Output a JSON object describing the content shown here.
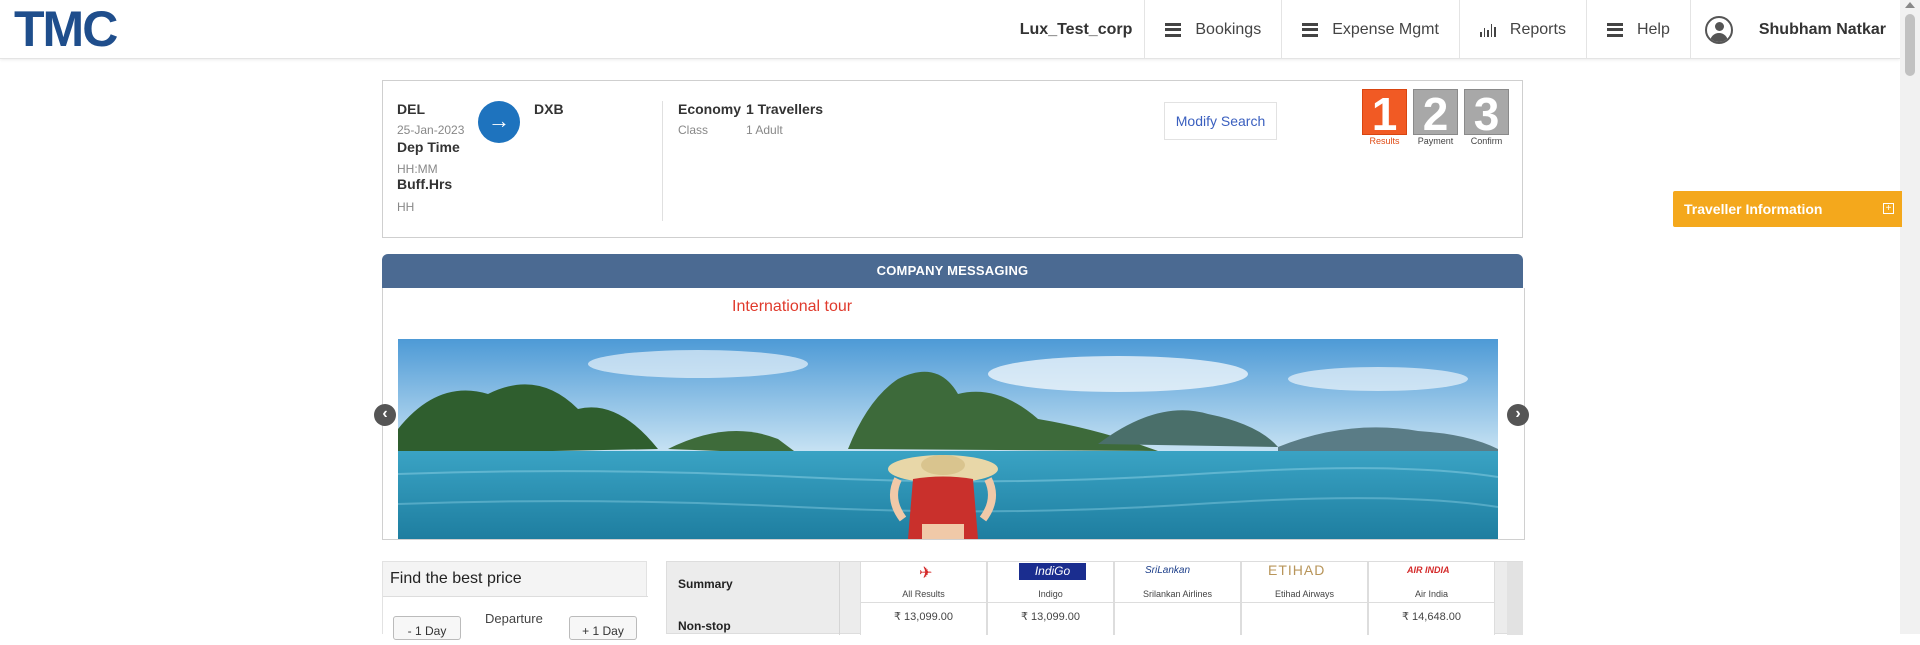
{
  "header": {
    "logo": "TMC",
    "corp": "Lux_Test_corp",
    "nav": [
      {
        "label": "Bookings",
        "icon": "menu-icon"
      },
      {
        "label": "Expense Mgmt",
        "icon": "menu-icon"
      },
      {
        "label": "Reports",
        "icon": "bar-chart-icon"
      },
      {
        "label": "Help",
        "icon": "menu-icon"
      }
    ],
    "user": "Shubham Natkar"
  },
  "search": {
    "from": "DEL",
    "date": "25-Jan-2023",
    "dep_time_label": "Dep Time",
    "dep_time_value": "HH:MM",
    "buff_label": "Buff.Hrs",
    "buff_value": "HH",
    "arrow": "→",
    "to": "DXB",
    "class_value": "Economy",
    "class_label": "Class",
    "travellers_value": "1 Travellers",
    "travellers_label": "1 Adult",
    "modify_label": "Modify Search"
  },
  "steps": [
    {
      "num": "1",
      "label": "Results",
      "active": true
    },
    {
      "num": "2",
      "label": "Payment",
      "active": false
    },
    {
      "num": "3",
      "label": "Confirm",
      "active": false
    }
  ],
  "messaging": {
    "header": "COMPANY MESSAGING",
    "title": "International tour",
    "prev": "‹",
    "next": "›"
  },
  "traveller_info": {
    "label": "Traveller Information",
    "toggle": "+"
  },
  "best_price": {
    "title": "Find the best price",
    "minus_day": "- 1 Day",
    "departure": "Departure",
    "plus_day": "+ 1 Day"
  },
  "matrix": {
    "summary_label": "Summary",
    "nonstop_label": "Non-stop",
    "columns": [
      {
        "name": "All Results",
        "price": "₹ 13,099.00"
      },
      {
        "name": "Indigo",
        "price": "₹ 13,099.00",
        "logo_text": "IndiGo"
      },
      {
        "name": "Srilankan Airlines",
        "price": "",
        "logo_text": "SriLankan"
      },
      {
        "name": "Etihad Airways",
        "price": "",
        "logo_text": "ETIHAD"
      },
      {
        "name": "Air India",
        "price": "₹ 14,648.00",
        "logo_text": "AIR INDIA"
      }
    ]
  },
  "colors": {
    "brand": "#1f4e8c",
    "accent_orange": "#f4a81c",
    "messaging_header": "#4b6a92",
    "step_active": "#f15a24",
    "route_arrow": "#1e73be"
  }
}
